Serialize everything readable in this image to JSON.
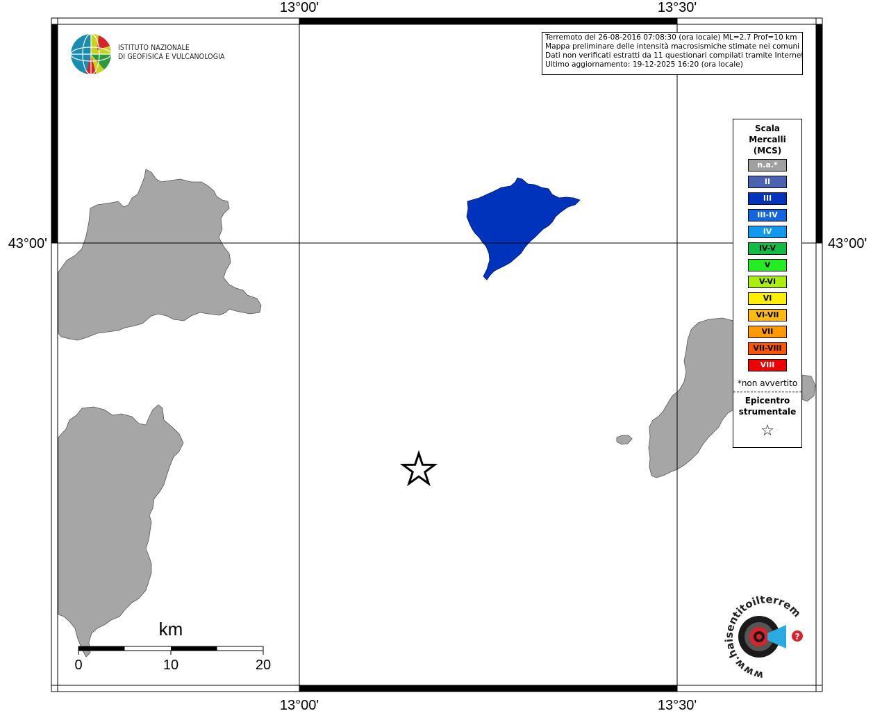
{
  "axis_labels": {
    "top": [
      "13°00'",
      "13°30'"
    ],
    "bottom": [
      "13°00'",
      "13°30'"
    ],
    "left": "43°00'",
    "right": "43°00'"
  },
  "info": {
    "line1": "Terremoto del 26-08-2016 07:08:30 (ora locale) ML=2.7 Prof=10 km",
    "line2": "Mappa preliminare delle intensità macrosismiche stimate nei comuni",
    "line3": "Dati non verificati estratti da 11 questionari compilati tramite Internet.",
    "line4": "Ultimo aggiornamento: 19-12-2025 16:20 (ora locale)"
  },
  "logo_ingv": {
    "line1": "ISTITUTO NAZIONALE",
    "line2": "DI GEOFISICA E VULCANOLOGIA"
  },
  "legend": {
    "title": "Scala Mercalli (MCS)",
    "items": [
      {
        "label": "n.a.*",
        "color": "#a0a0a0",
        "text_color": "#ffffff"
      },
      {
        "label": "II",
        "color": "#4a63b0",
        "text_color": "#ffffff"
      },
      {
        "label": "III",
        "color": "#0033bb",
        "text_color": "#ffffff"
      },
      {
        "label": "III-IV",
        "color": "#1166dd",
        "text_color": "#ffffff"
      },
      {
        "label": "IV",
        "color": "#1199ee",
        "text_color": "#ffffff"
      },
      {
        "label": "IV-V",
        "color": "#11bb44",
        "text_color": "#000000"
      },
      {
        "label": "V",
        "color": "#22ee22",
        "text_color": "#000000"
      },
      {
        "label": "V-VI",
        "color": "#aaee11",
        "text_color": "#000000"
      },
      {
        "label": "VI",
        "color": "#ffee00",
        "text_color": "#000000"
      },
      {
        "label": "VI-VII",
        "color": "#ffbb11",
        "text_color": "#000000"
      },
      {
        "label": "VII",
        "color": "#ff9900",
        "text_color": "#000000"
      },
      {
        "label": "VII-VIII",
        "color": "#ff5500",
        "text_color": "#000000"
      },
      {
        "label": "VIII",
        "color": "#ee0000",
        "text_color": "#ffffff"
      }
    ],
    "note": "*non avvertito",
    "epicenter_label": "Epicentro strumentale",
    "epicenter_symbol": "☆"
  },
  "scale_bar": {
    "unit": "km",
    "ticks": [
      "0",
      "10",
      "20"
    ]
  },
  "colors": {
    "land": "#a6a6a6",
    "intensity_iii": "#0033bb"
  },
  "logo_hsit": "www.haisentitoilterremoto.it"
}
